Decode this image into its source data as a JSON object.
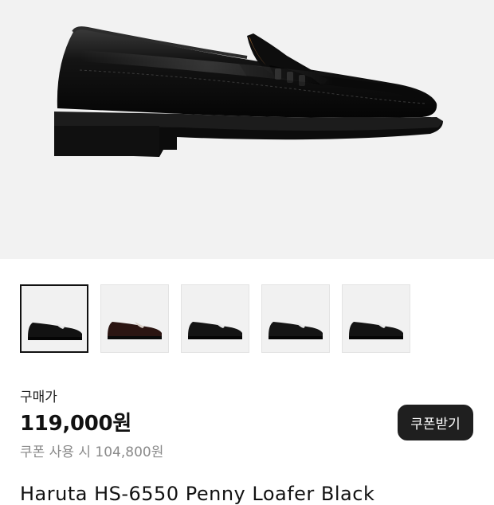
{
  "product": {
    "hero_image": "black-penny-loafer-side-view",
    "thumbnails": [
      {
        "image": "black-loafer",
        "color": "#121212",
        "selected": true
      },
      {
        "image": "dark-brown-loafer",
        "color": "#2b1512",
        "selected": false
      },
      {
        "image": "black-loafer",
        "color": "#141414",
        "selected": false
      },
      {
        "image": "black-loafer",
        "color": "#151515",
        "selected": false
      },
      {
        "image": "black-loafer",
        "color": "#131313",
        "selected": false
      }
    ],
    "price_label": "구매가",
    "price": "119,000원",
    "coupon_price": "쿠폰 사용 시 104,800원",
    "coupon_button_label": "쿠폰받기",
    "name_partial": "Haruta HS-6550 Penny Loafer Black"
  },
  "colors": {
    "hero_bg": "#f2f2f2",
    "button_bg": "#1f1f1f",
    "secondary_text": "#8a8a8a"
  }
}
